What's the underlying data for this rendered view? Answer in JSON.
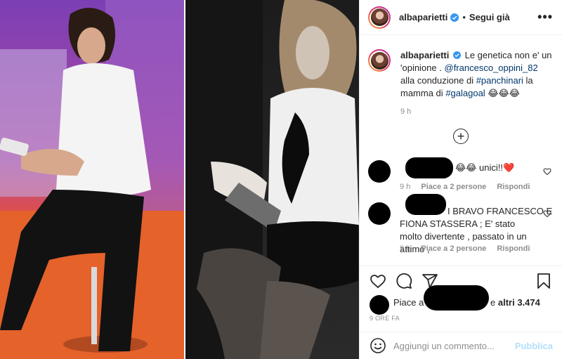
{
  "header": {
    "username": "albaparietti",
    "separator": "•",
    "follow_label": "Segui già",
    "more_icon": "more-options-icon"
  },
  "post": {
    "caption_username": "albaparietti",
    "caption_part1": "Le genetica non e' un 'opinione .",
    "mention": "@francesco_oppini_82",
    "caption_part2": "alla conduzione di",
    "hashtag1": "#panchinari",
    "caption_part3": "la mamma di",
    "hashtag2": "#galagoal",
    "emojis": "😂😂😂",
    "time": "9 h"
  },
  "comments": [
    {
      "text": "😂😂 unici!!❤️",
      "time": "9 h",
      "likes": "Piace a 2 persone",
      "reply": "Rispondi"
    },
    {
      "text_line1": "I BRAVO FRANCESCO E",
      "text_rest": "FIONA STASSERA ; E' stato molto divertente , passato in un attimo ,",
      "time": "9 h",
      "likes": "Piace a 2 persone",
      "reply": "Rispondi"
    }
  ],
  "likes": {
    "prefix": "Piace a",
    "suffix_connector": "e",
    "count": "altri 3.474"
  },
  "age": "9 ORE FA",
  "add_comment": {
    "placeholder": "Aggiungi un commento...",
    "publish_label": "Pubblica"
  },
  "colors": {
    "link": "#00376b",
    "muted": "#8e8e8e",
    "publish_disabled": "#b2dffc",
    "verified": "#3897f0"
  }
}
